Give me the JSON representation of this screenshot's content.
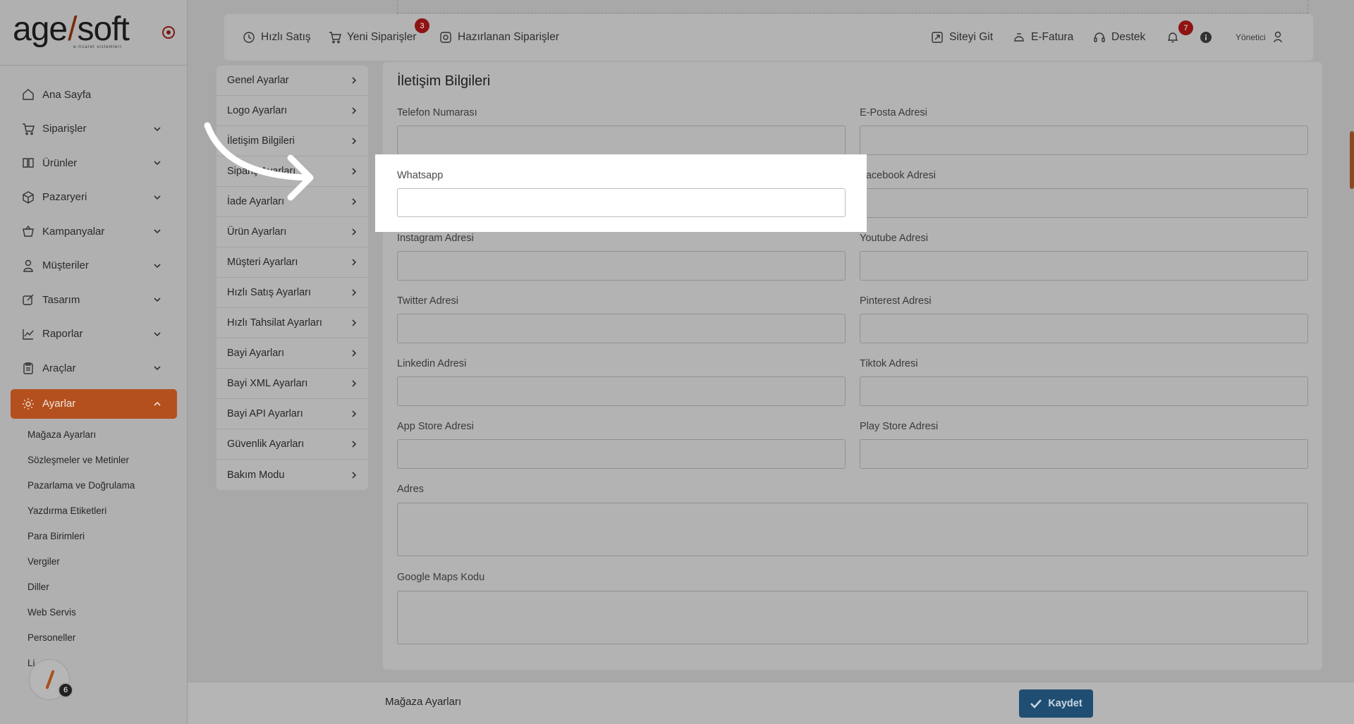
{
  "brand": {
    "name_main": "age",
    "name_slash": "/",
    "name_soft": "soft",
    "tagline": "e-ticaret sistemleri"
  },
  "sidebar": {
    "items": [
      {
        "label": "Ana Sayfa",
        "icon": "home-icon",
        "expandable": false
      },
      {
        "label": "Siparişler",
        "icon": "cart-icon",
        "expandable": true
      },
      {
        "label": "Ürünler",
        "icon": "book-icon",
        "expandable": true
      },
      {
        "label": "Pazaryeri",
        "icon": "box-icon",
        "expandable": true
      },
      {
        "label": "Kampanyalar",
        "icon": "basket-icon",
        "expandable": true
      },
      {
        "label": "Müşteriler",
        "icon": "user-icon",
        "expandable": true
      },
      {
        "label": "Tasarım",
        "icon": "edit-icon",
        "expandable": true
      },
      {
        "label": "Raporlar",
        "icon": "chart-icon",
        "expandable": true
      },
      {
        "label": "Araçlar",
        "icon": "clipboard-icon",
        "expandable": true
      },
      {
        "label": "Ayarlar",
        "icon": "gear-icon",
        "expandable": true,
        "active": true
      }
    ],
    "subitems": [
      "Mağaza Ayarları",
      "Sözleşmeler ve Metinler",
      "Pazarlama ve Doğrulama",
      "Yazdırma Etiketleri",
      "Para Birimleri",
      "Vergiler",
      "Diller",
      "Web Servis",
      "Personeller",
      "Li"
    ],
    "float_badge": "6"
  },
  "topbar": {
    "quick_sale": "Hızlı Satış",
    "new_orders": "Yeni Siparişler",
    "new_orders_badge": "3",
    "prepared_orders": "Hazırlanan Siparişler",
    "go_site": "Siteyi Git",
    "einvoice": "E-Fatura",
    "support": "Destek",
    "notifications_badge": "7",
    "user": "Yönetici"
  },
  "settings_menu": [
    "Genel Ayarlar",
    "Logo Ayarları",
    "İletişim Bilgileri",
    "Sipariş Ayarları",
    "İade Ayarları",
    "Ürün Ayarları",
    "Müşteri Ayarları",
    "Hızlı Satış Ayarları",
    "Hızlı Tahsilat Ayarları",
    "Bayi Ayarları",
    "Bayi XML Ayarları",
    "Bayi API Ayarları",
    "Güvenlik Ayarları",
    "Bakım Modu"
  ],
  "form": {
    "title": "İletişim Bilgileri",
    "phone": {
      "label": "Telefon Numarası",
      "value": ""
    },
    "email": {
      "label": "E-Posta Adresi",
      "value": ""
    },
    "whatsapp": {
      "label": "Whatsapp",
      "value": ""
    },
    "facebook": {
      "label": "Facebook Adresi",
      "value": ""
    },
    "instagram": {
      "label": "Instagram Adresi",
      "value": ""
    },
    "youtube": {
      "label": "Youtube Adresi",
      "value": ""
    },
    "twitter": {
      "label": "Twitter Adresi",
      "value": ""
    },
    "pinterest": {
      "label": "Pinterest Adresi",
      "value": ""
    },
    "linkedin": {
      "label": "Linkedin Adresi",
      "value": ""
    },
    "tiktok": {
      "label": "Tiktok Adresi",
      "value": ""
    },
    "appstore": {
      "label": "App Store Adresi",
      "value": ""
    },
    "playstore": {
      "label": "Play Store Adresi",
      "value": ""
    },
    "address": {
      "label": "Adres",
      "value": ""
    },
    "maps": {
      "label": "Google Maps Kodu",
      "value": ""
    }
  },
  "footer": {
    "label": "Mağaza Ayarları",
    "save_label": "Kaydet"
  },
  "colors": {
    "accent": "#b4501e",
    "save": "#1f4e72",
    "badge": "#8e1414"
  }
}
